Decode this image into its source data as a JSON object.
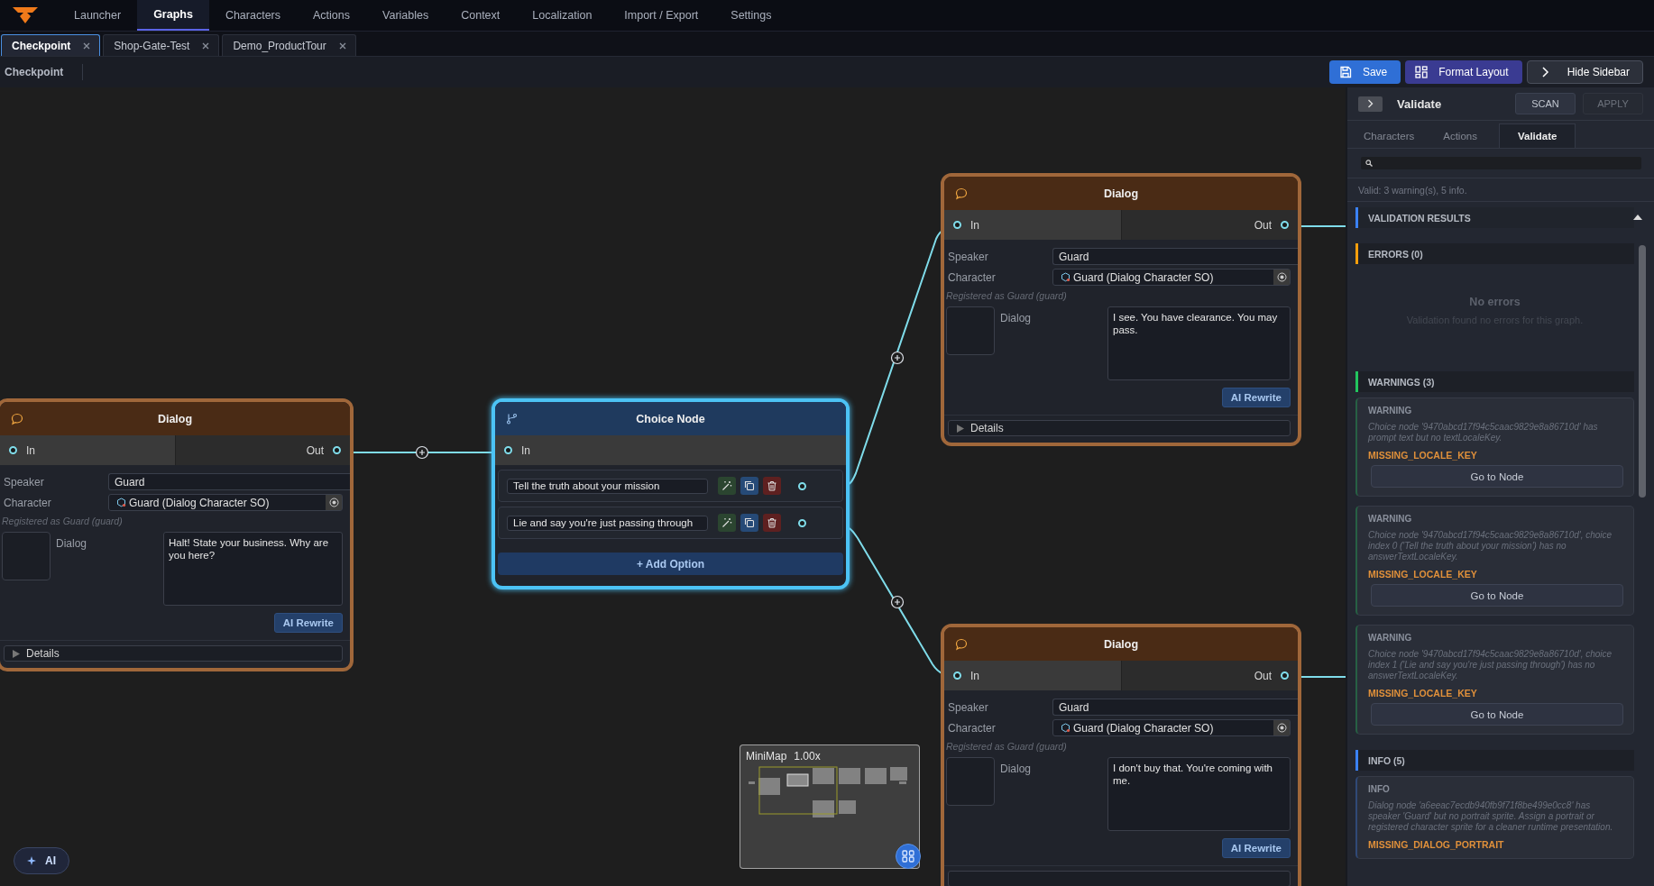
{
  "menu": [
    {
      "label": "Launcher",
      "selected": false
    },
    {
      "label": "Graphs",
      "selected": true
    },
    {
      "label": "Characters",
      "selected": false
    },
    {
      "label": "Actions",
      "selected": false
    },
    {
      "label": "Variables",
      "selected": false
    },
    {
      "label": "Context",
      "selected": false
    },
    {
      "label": "Localization",
      "selected": false
    },
    {
      "label": "Import / Export",
      "selected": false
    },
    {
      "label": "Settings",
      "selected": false
    }
  ],
  "tabs": [
    {
      "label": "Checkpoint",
      "selected": true
    },
    {
      "label": "Shop-Gate-Test",
      "selected": false
    },
    {
      "label": "Demo_ProductTour",
      "selected": false
    }
  ],
  "toolbar": {
    "title": "Checkpoint",
    "buttons": [
      {
        "kind": "save",
        "label": "Save"
      },
      {
        "kind": "format",
        "label": "Format Layout"
      },
      {
        "kind": "hide",
        "label": "Hide Sidebar"
      }
    ]
  },
  "canvas": {
    "nodes": [
      {
        "kind": "dialog",
        "selected": false,
        "title": "Dialog",
        "in_label": "In",
        "out_label": "Out",
        "speaker_label": "Speaker",
        "speaker": "Guard",
        "character_label": "Character",
        "character": "Guard (Dialog Character SO)",
        "registered": "Registered as Guard (guard)",
        "dialog_label": "Dialog",
        "dialog_text": "Halt! State your business. Why are you here?",
        "rewrite": "AI Rewrite",
        "details": "Details"
      },
      {
        "kind": "choice",
        "selected": true,
        "title": "Choice Node",
        "in_label": "In",
        "options": [
          {
            "text": "Tell the truth about your mission"
          },
          {
            "text": "Lie and say you're just passing through"
          }
        ],
        "add_label": "+ Add Option"
      },
      {
        "kind": "dialog",
        "selected": false,
        "title": "Dialog",
        "in_label": "In",
        "out_label": "Out",
        "speaker_label": "Speaker",
        "speaker": "Guard",
        "character_label": "Character",
        "character": "Guard (Dialog Character SO)",
        "registered": "Registered as Guard (guard)",
        "dialog_label": "Dialog",
        "dialog_text": "I see. You have clearance. You may pass.",
        "rewrite": "AI Rewrite",
        "details": "Details"
      },
      {
        "kind": "dialog",
        "selected": false,
        "title": "Dialog",
        "in_label": "In",
        "out_label": "Out",
        "speaker_label": "Speaker",
        "speaker": "Guard",
        "character_label": "Character",
        "character": "Guard (Dialog Character SO)",
        "registered": "Registered as Guard (guard)",
        "dialog_label": "Dialog",
        "dialog_text": "I don't buy that. You're coming with me.",
        "rewrite": "AI Rewrite"
      }
    ],
    "ai_button": {
      "label": "AI"
    },
    "minimap": {
      "title": "MiniMap",
      "zoom": "1.00x"
    }
  },
  "sidebar": {
    "title": "Validate",
    "scan": {
      "label": "SCAN",
      "disabled": false
    },
    "apply": {
      "label": "APPLY",
      "disabled": true
    },
    "tabs": [
      {
        "label": "Characters",
        "selected": false
      },
      {
        "label": "Actions",
        "selected": false
      },
      {
        "label": "Validate",
        "selected": true
      }
    ],
    "summary": "Valid: 3 warning(s), 5 info.",
    "sections": [
      {
        "kind": "header",
        "title": "VALIDATION RESULTS",
        "color": "#3b82f6",
        "expanded": true
      },
      {
        "kind": "group",
        "title": "ERRORS (0)",
        "color": "#f59e0b",
        "empty_title": "No errors",
        "empty_text": "Validation found no errors for this graph."
      },
      {
        "kind": "group",
        "title": "WARNINGS (3)",
        "color": "#22c55e",
        "items": [
          {
            "level": "WARNING",
            "message": "Choice node '9470abcd17f94c5caac9829e8a86710d' has prompt text but no textLocaleKey.",
            "code": "MISSING_LOCALE_KEY",
            "action": "Go to Node"
          },
          {
            "level": "WARNING",
            "message": "Choice node '9470abcd17f94c5caac9829e8a86710d', choice index 0 ('Tell the truth about your mission') has no answerTextLocaleKey.",
            "code": "MISSING_LOCALE_KEY",
            "action": "Go to Node"
          },
          {
            "level": "WARNING",
            "message": "Choice node '9470abcd17f94c5caac9829e8a86710d', choice index 1 ('Lie and say you're just passing through') has no answerTextLocaleKey.",
            "code": "MISSING_LOCALE_KEY",
            "action": "Go to Node"
          }
        ]
      },
      {
        "kind": "group",
        "title": "INFO (5)",
        "color": "#3b82f6",
        "items": [
          {
            "level": "INFO",
            "message": "Dialog node 'a6eeac7ecdb940fb9f71f8be499e0cc8' has speaker 'Guard' but no portrait sprite. Assign a portrait or registered character sprite for a cleaner runtime presentation.",
            "code": "MISSING_DIALOG_PORTRAIT"
          }
        ]
      }
    ]
  }
}
